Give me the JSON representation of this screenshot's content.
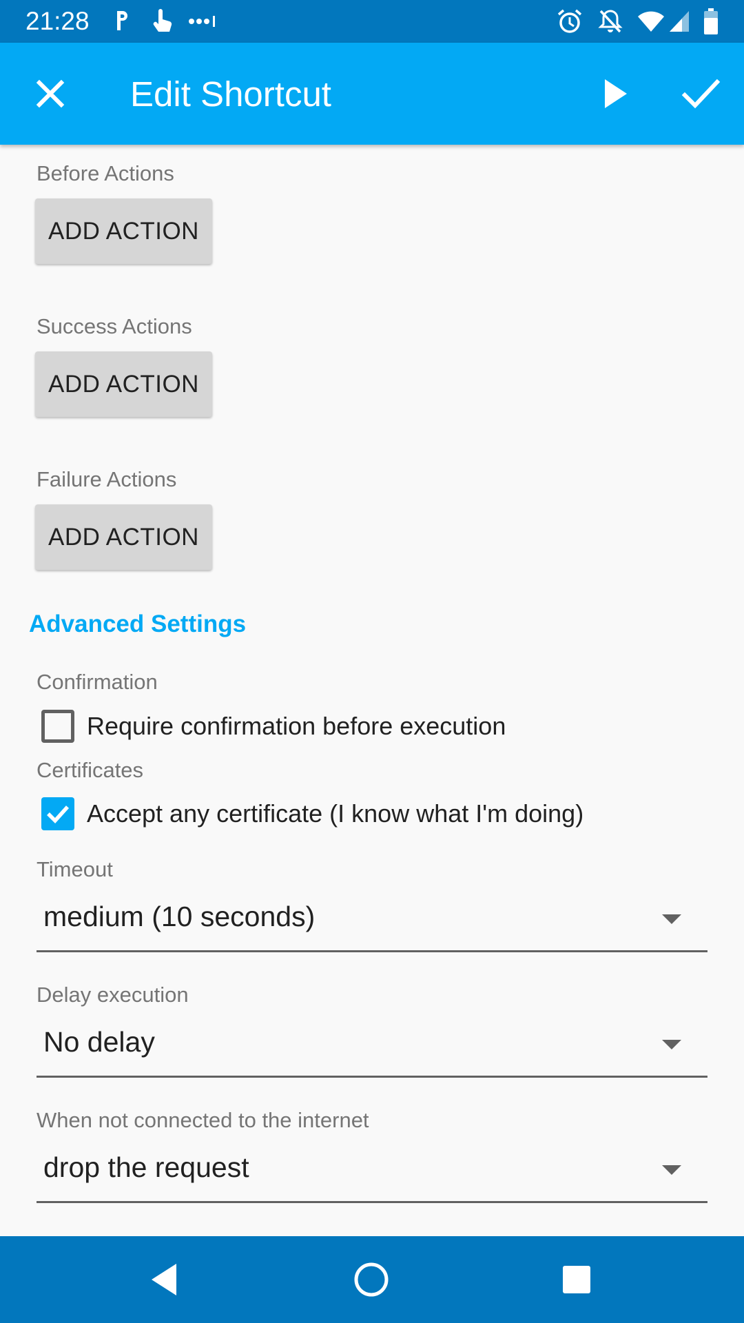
{
  "status_bar": {
    "time": "21:28",
    "left_icons": [
      "parking-app-icon",
      "touch-app-icon",
      "more-dots-icon"
    ],
    "right_icons": [
      "alarm-icon",
      "notifications-off-icon",
      "wifi-icon",
      "signal-icon",
      "battery-icon"
    ]
  },
  "app_bar": {
    "title": "Edit Shortcut",
    "close_icon": "close-icon",
    "play_icon": "play-icon",
    "check_icon": "check-icon",
    "background_color": "#03a9f4"
  },
  "actions": {
    "before_label": "Before Actions",
    "success_label": "Success Actions",
    "failure_label": "Failure Actions",
    "add_action_label": "ADD ACTION"
  },
  "advanced": {
    "title": "Advanced Settings",
    "confirmation_label": "Confirmation",
    "confirmation_checkbox_label": "Require confirmation before execution",
    "confirmation_checked": false,
    "certificates_label": "Certificates",
    "certificates_checkbox_label": "Accept any certificate (I know what I'm doing)",
    "certificates_checked": true,
    "timeout_label": "Timeout",
    "timeout_value": "medium (10 seconds)",
    "delay_label": "Delay execution",
    "delay_value": "No delay",
    "offline_label": "When not connected to the internet",
    "offline_value": "drop the request"
  },
  "nav_bar": {
    "back_icon": "back-triangle-icon",
    "home_icon": "home-circle-icon",
    "recents_icon": "recents-square-icon",
    "background_color": "#0277bd"
  }
}
